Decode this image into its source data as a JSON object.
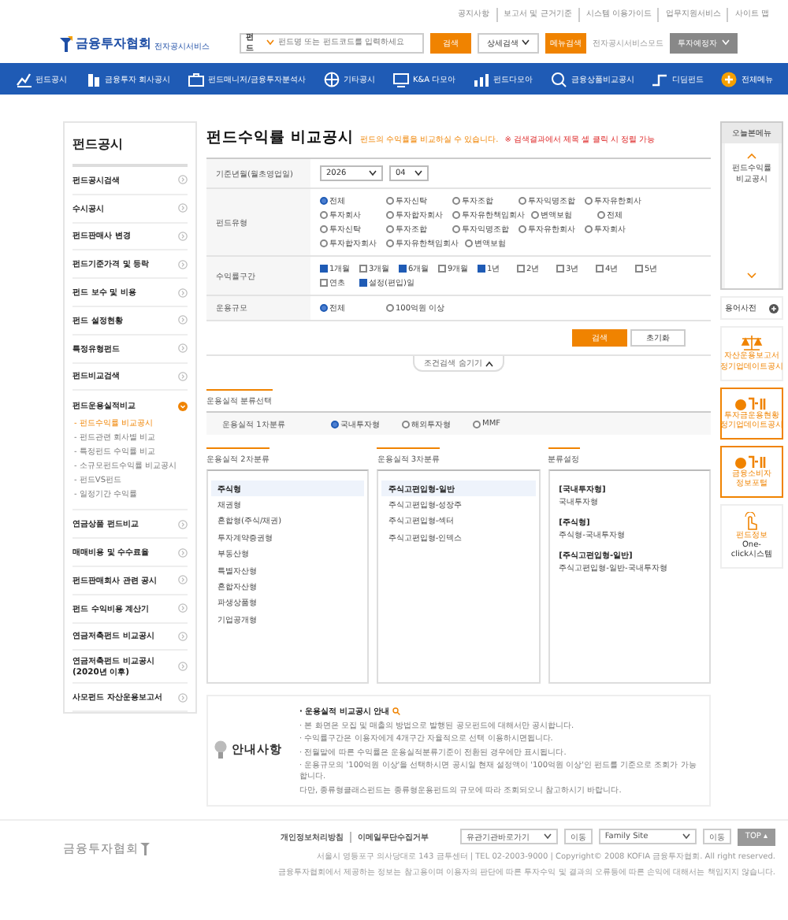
{
  "top_links": [
    "공지사항",
    "보고서 및 근거기준",
    "시스템 이용가이드",
    "업무지원서비스",
    "사이트 맵"
  ],
  "header": {
    "logo": "금융투자협회",
    "logo_sub": "전자공시서비스",
    "search_category": "펀드",
    "search_placeholder": "펀드명 또는 펀드코드를 입력하세요",
    "search_button": "검색",
    "detail_search": "상세검색",
    "menu_search": "메뉴검색",
    "mode_link": "전자공시서비스모드",
    "user_type": "투자예정자"
  },
  "nav": [
    {
      "label": "펀드공시",
      "kind": "chart"
    },
    {
      "label": "금융투자 회사공시",
      "kind": "building"
    },
    {
      "label": "펀드매니저/금융투자분석사",
      "kind": "briefcase"
    },
    {
      "label": "기타공시",
      "kind": "globe"
    },
    {
      "label": "K&A 다모아",
      "kind": "monitor"
    },
    {
      "label": "펀드다모아",
      "kind": "bars"
    },
    {
      "label": "금융상품비교공시",
      "kind": "magnifier"
    },
    {
      "label": "디딤펀드",
      "kind": "step"
    },
    {
      "label": "전체메뉴",
      "kind": "plus"
    }
  ],
  "sidebar": {
    "title": "펀드공시",
    "items": [
      {
        "label": "펀드공시검색",
        "expanded": false
      },
      {
        "label": "수시공시",
        "expanded": false
      },
      {
        "label": "펀드판매사 변경",
        "expanded": false
      },
      {
        "label": "펀드기준가격 및 등락",
        "expanded": false
      },
      {
        "label": "펀드 보수 및 비용",
        "expanded": false
      },
      {
        "label": "펀드 설정현황",
        "expanded": false
      },
      {
        "label": "특정유형펀드",
        "expanded": false
      },
      {
        "label": "펀드비교검색",
        "expanded": false
      },
      {
        "label": "펀드운용실적비교",
        "expanded": true,
        "children": [
          {
            "label": "- 펀드수익률 비교공시",
            "selected": true
          },
          {
            "label": "- 펀드관련 회사별 비교",
            "selected": false
          },
          {
            "label": "- 특정펀드 수익률 비교",
            "selected": false
          },
          {
            "label": "- 소규모펀드수익률 비교공시",
            "selected": false
          },
          {
            "label": "- 펀드VS펀드",
            "selected": false
          },
          {
            "label": "- 일정기간 수익률",
            "selected": false
          }
        ]
      },
      {
        "label": "연금상품 펀드비교",
        "expanded": false
      },
      {
        "label": "매매비용 및 수수료율",
        "expanded": false
      },
      {
        "label": "펀드판매회사 관련 공시",
        "expanded": false
      },
      {
        "label": "펀드 수익비용 계산기",
        "expanded": false
      },
      {
        "label": "연금저축펀드 비교공시",
        "expanded": false
      },
      {
        "label": "연금저축펀드 비교공시 (2020년 이후)",
        "expanded": false
      },
      {
        "label": "사모펀드 자산운용보고서",
        "expanded": false
      }
    ]
  },
  "page": {
    "title": "펀드수익률 비교공시",
    "subtitle": "펀드의 수익률을 비교하실 수 있습니다.",
    "note": "※ 검색결과에서 제목 셀 클릭 시 정렬 가능"
  },
  "form": {
    "rows": [
      {
        "label": "기준년월(월초영업일)",
        "kind": "selects",
        "selects": [
          "2026",
          "04"
        ]
      },
      {
        "label": "펀드유형",
        "kind": "radios",
        "options": [
          {
            "label": "전체",
            "selected": true
          },
          {
            "label": "투자신탁",
            "selected": false
          },
          {
            "label": "투자조합",
            "selected": false
          },
          {
            "label": "투자익명조합",
            "selected": false
          },
          {
            "label": "투자유한회사",
            "selected": false
          },
          {
            "label": "투자회사",
            "selected": false
          },
          {
            "label": "투자합자회사",
            "selected": false
          },
          {
            "label": "투자유한책임회사",
            "selected": false
          },
          {
            "label": "변액보험",
            "selected": false
          },
          {
            "label": "전체",
            "selected": false
          },
          {
            "label": "투자신탁",
            "selected": false
          },
          {
            "label": "투자조합",
            "selected": false
          },
          {
            "label": "투자익명조합",
            "selected": false
          },
          {
            "label": "투자유한회사",
            "selected": false
          },
          {
            "label": "투자회사",
            "selected": false
          },
          {
            "label": "투자합자회사",
            "selected": false
          },
          {
            "label": "투자유한책임회사",
            "selected": false
          },
          {
            "label": "변액보험",
            "selected": false
          }
        ]
      },
      {
        "label": "수익률구간",
        "kind": "checkboxes",
        "options": [
          {
            "label": "1개월",
            "checked": true
          },
          {
            "label": "3개월",
            "checked": false
          },
          {
            "label": "6개월",
            "checked": true
          },
          {
            "label": "9개월",
            "checked": false
          },
          {
            "label": "1년",
            "checked": true
          },
          {
            "label": "2년",
            "checked": false
          },
          {
            "label": "3년",
            "checked": false
          },
          {
            "label": "4년",
            "checked": false
          },
          {
            "label": "5년",
            "checked": false
          },
          {
            "label": "연초",
            "checked": false
          },
          {
            "label": "설정(편입)일",
            "checked": true
          }
        ]
      },
      {
        "label": "운용규모",
        "kind": "radios",
        "options": [
          {
            "label": "전체",
            "selected": true
          },
          {
            "label": "100억원 이상",
            "selected": false
          }
        ]
      }
    ],
    "buttons": [
      {
        "label": "검색",
        "kind": "primary"
      },
      {
        "label": "초기화",
        "kind": "secondary"
      }
    ],
    "toggle": "조건검색 숨기기"
  },
  "classification": {
    "title": "운용실적 분류선택",
    "row_label": "운용실적 1차분류",
    "options": [
      {
        "label": "국내투자형",
        "selected": true
      },
      {
        "label": "해외투자형",
        "selected": false
      },
      {
        "label": "MMF",
        "selected": false
      }
    ]
  },
  "columns": [
    {
      "title": "운용실적 2차분류",
      "kind": "list",
      "items": [
        {
          "label": "주식형",
          "selected": true
        },
        {
          "label": "채권형",
          "selected": false
        },
        {
          "label": "혼합형(주식/채권)",
          "selected": false
        },
        {
          "label": "투자계약증권형",
          "selected": false
        },
        {
          "label": "부동산형",
          "selected": false
        },
        {
          "label": "특별자산형",
          "selected": false
        },
        {
          "label": "혼합자산형",
          "selected": false
        },
        {
          "label": "파생상품형",
          "selected": false
        },
        {
          "label": "기업공개형",
          "selected": false
        }
      ]
    },
    {
      "title": "운용실적 3차분류",
      "kind": "list",
      "items": [
        {
          "label": "주식고편입형-일반",
          "selected": true
        },
        {
          "label": "주식고편입형-성장주",
          "selected": false
        },
        {
          "label": "주식고편입형-섹터",
          "selected": false
        },
        {
          "label": "주식고편입형-인덱스",
          "selected": false
        }
      ]
    },
    {
      "title": "분류설정",
      "kind": "settings",
      "groups": [
        {
          "heading": "[국내투자형]",
          "value": "국내투자형"
        },
        {
          "heading": "[주식형]",
          "value": "주식형-국내투자형"
        },
        {
          "heading": "[주식고편입형-일반]",
          "value": "주식고편입형-일반-국내투자형"
        }
      ]
    }
  ],
  "notice": {
    "title": "안내사항",
    "heading": "· 운용실적 비교공시 안내",
    "lines": [
      "· 본 화면은 모집 및 매출의 방법으로 발행된 공모펀드에 대해서만 공시합니다.",
      "· 수익률구간은 이용자에게 4개구간 자율적으로 선택 이용하시면됩니다.",
      "· 전월말에 따른 수익률은 운용실적분류기준이 전환된 경우에만 표시됩니다.",
      "· 운용규모의 '100억원 이상'을 선택하시면 공시일 현재 설정액이 '100억원 이상'인 펀드를 기준으로 조회가 가능합니다.",
      "다만, 종류형클래스펀드는 종류형운용펀드의 규모에 따라 조회되오니 참고하시기 바랍니다."
    ]
  },
  "footer": {
    "logo": "금융투자협회",
    "links": [
      "개인정보처리방침",
      "이메일무단수집거부"
    ],
    "selects": [
      {
        "value": "유관기관바로가기",
        "button": "이동"
      },
      {
        "value": "Family Site",
        "button": "이동"
      }
    ],
    "top": "TOP ▴",
    "lines": [
      "서울시 영등포구 의사당대로 143 금투센터 | TEL 02-2003-9000 | Copyright© 2008 KOFIA 금융투자협회. All right reserved.",
      "금융투자협회에서 제공하는 정보는 참고용이며 이용자의 판단에 따른 투자수익 및 결과의 오류등에 따른 손익에 대해서는 책임지지 않습니다."
    ]
  },
  "right": {
    "recent_title": "오늘본메뉴",
    "recent_items": [
      "펀드수익률 비교공시"
    ],
    "glossary": "용어사전",
    "banners": [
      {
        "kind": "scale",
        "lines": [
          "자산운용보고서",
          "정기업데이트공시"
        ]
      },
      {
        "kind": "fine",
        "lines": [
          "투자금운용현황",
          "정기업데이트공시"
        ]
      },
      {
        "kind": "fine",
        "lines": [
          "금융소비자 정보포털"
        ]
      },
      {
        "kind": "hand",
        "lines": [
          "펀드정보",
          "One-click시스템"
        ]
      }
    ]
  }
}
